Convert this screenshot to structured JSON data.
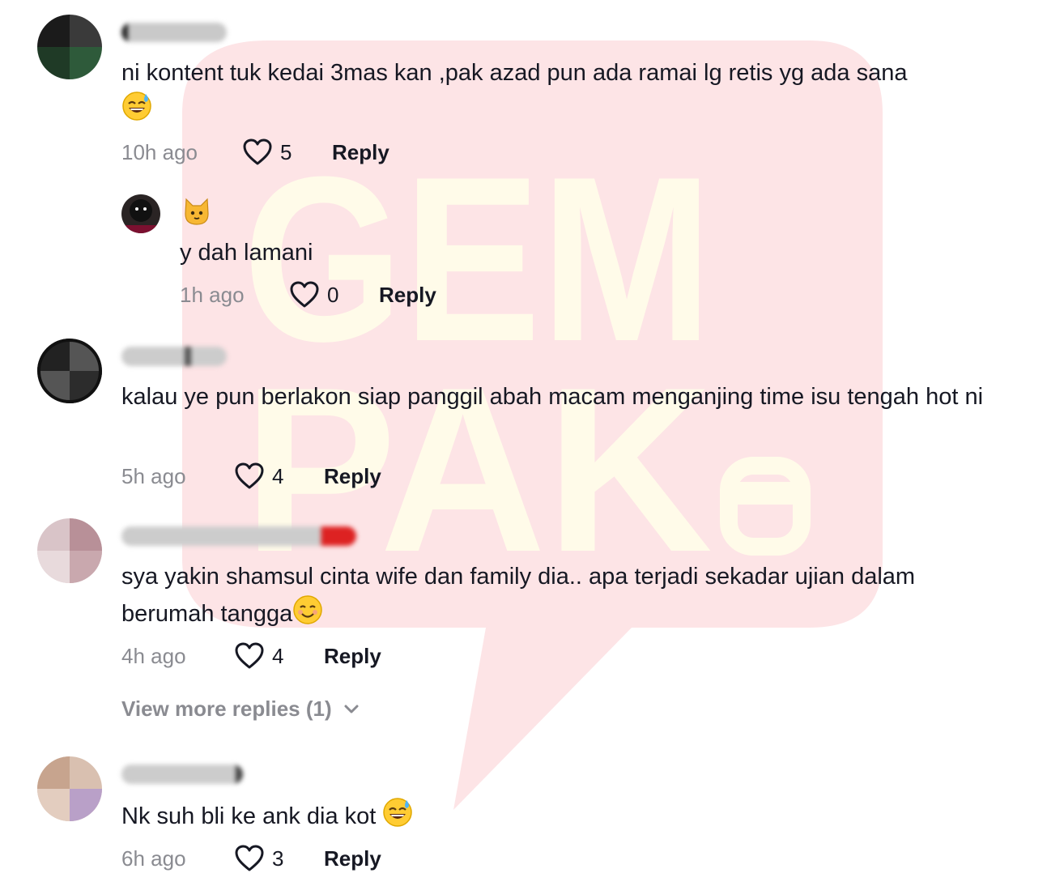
{
  "comments": [
    {
      "text": "ni kontent tuk kedai 3mas kan ,pak azad pun ada ramai lg retis yg ada sana",
      "emoji": "sweat-smile",
      "time": "10h ago",
      "likes": "5",
      "reply_label": "Reply",
      "reply": {
        "username_emoji": "cat-face",
        "text": "y dah lamani",
        "time": "1h ago",
        "likes": "0",
        "reply_label": "Reply"
      }
    },
    {
      "text": "kalau ye pun berlakon siap panggil abah macam menganjing time isu tengah hot ni",
      "time": "5h ago",
      "likes": "4",
      "reply_label": "Reply"
    },
    {
      "text": "sya yakin shamsul cinta wife dan family dia.. apa terjadi sekadar ujian dalam berumah tangga",
      "emoji": "smiling-face",
      "time": "4h ago",
      "likes": "4",
      "reply_label": "Reply",
      "view_more": "View more replies (1)"
    },
    {
      "text": "Nk suh bli ke ank dia kot",
      "emoji": "sweat-smile",
      "time": "6h ago",
      "likes": "3",
      "reply_label": "Reply"
    }
  ],
  "watermark": {
    "line1": "GEM",
    "line2": "PAK",
    "colors": {
      "bubble": "#fde4e6",
      "letters": "#fffbe9"
    }
  },
  "colors": {
    "text": "#161823",
    "muted": "#8a8b91",
    "background": "#ffffff"
  }
}
